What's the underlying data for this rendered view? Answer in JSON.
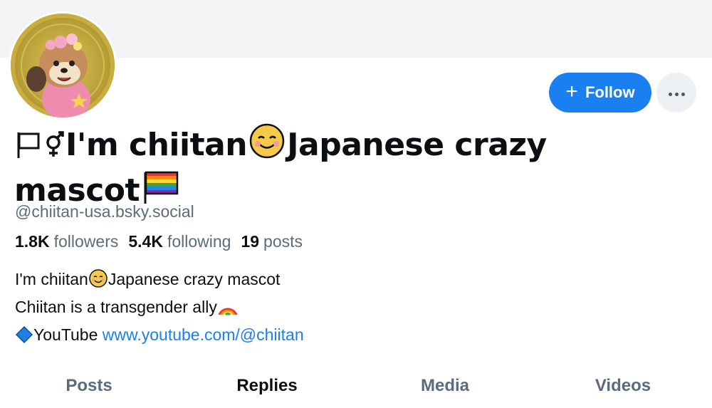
{
  "profile": {
    "display_name_part1": "I'm chiitan",
    "display_name_part2": "Japanese crazy",
    "display_name_part3": "mascot",
    "handle": "@chiitan-usa.bsky.social",
    "avatar_alt": "chiitan avatar"
  },
  "actions": {
    "follow_label": "Follow",
    "follow_icon": "plus-icon",
    "more_icon": "ellipsis-icon"
  },
  "stats": {
    "followers_count": "1.8K",
    "followers_label": "followers",
    "following_count": "5.4K",
    "following_label": "following",
    "posts_count": "19",
    "posts_label": "posts"
  },
  "bio": {
    "line1_a": "I'm chiitan",
    "line1_b": "Japanese crazy mascot",
    "line2": "Chiitan is a transgender ally",
    "line3_label": "YouTube",
    "line3_link": "www.youtube.com/@chiitan"
  },
  "tabs": [
    {
      "label": "Posts",
      "active": false
    },
    {
      "label": "Replies",
      "active": true
    },
    {
      "label": "Media",
      "active": false
    },
    {
      "label": "Videos",
      "active": false
    }
  ],
  "colors": {
    "accent": "#1a7ff0",
    "muted_text": "#5c6b7a",
    "banner": "#f1f3f5"
  }
}
